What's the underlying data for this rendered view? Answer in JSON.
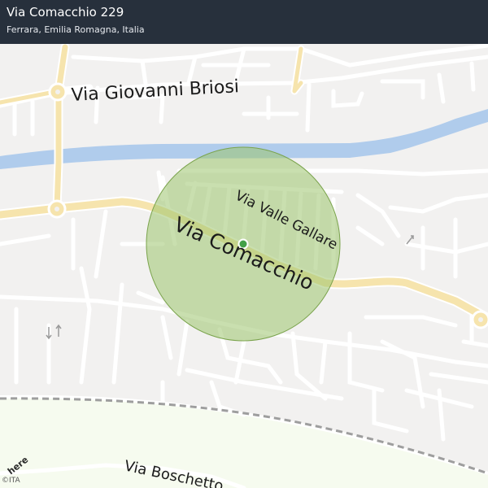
{
  "header": {
    "title": "Via Comacchio 229",
    "subtitle": "Ferrara, Emilia Romagna, Italia"
  },
  "streets": {
    "briosi": "Via   Giovanni   Briosi",
    "valle_gallare": "Via  Valle  Gallare",
    "comacchio": "Via  Comacchio",
    "boschetto": "Via  Boschetto"
  },
  "footer": {
    "logo": "here",
    "copyright": "©ITA"
  },
  "colors": {
    "land": "#f2f1f0",
    "river": "#b0ccec",
    "main_road": "#f6e4ad",
    "accuracy_circle": "#9cc46e",
    "location_dot": "#43a047",
    "header_bg": "#1e2834"
  }
}
